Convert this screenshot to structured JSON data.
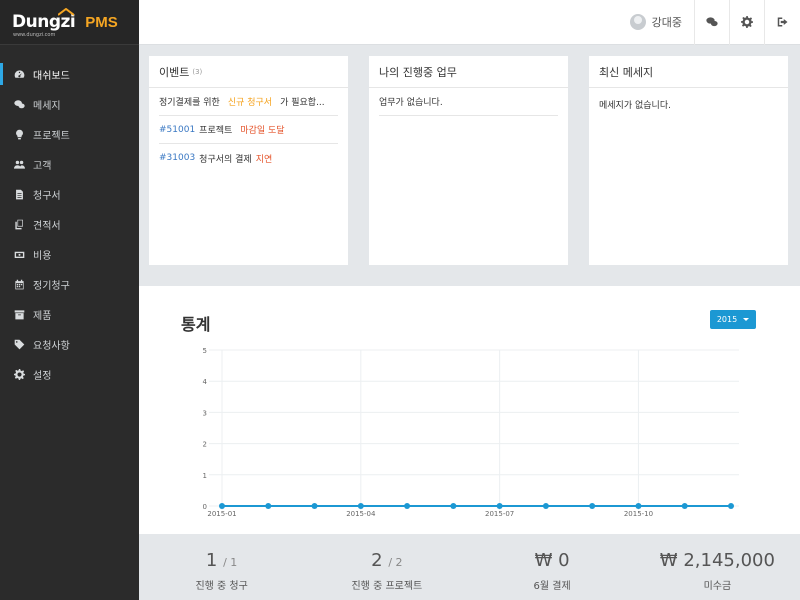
{
  "brand": {
    "logo": "Dungzi",
    "logo_sub": "www.dungzi.com",
    "product": "PMS"
  },
  "sidebar": {
    "items": [
      {
        "label": "대쉬보드",
        "icon": "dashboard-icon",
        "active": true
      },
      {
        "label": "메세지",
        "icon": "chat-icon"
      },
      {
        "label": "프로젝트",
        "icon": "lightbulb-icon"
      },
      {
        "label": "고객",
        "icon": "users-icon"
      },
      {
        "label": "청구서",
        "icon": "document-icon"
      },
      {
        "label": "견적서",
        "icon": "copy-icon"
      },
      {
        "label": "비용",
        "icon": "money-icon"
      },
      {
        "label": "정기청구",
        "icon": "calendar-icon"
      },
      {
        "label": "제품",
        "icon": "archive-icon"
      },
      {
        "label": "요청사항",
        "icon": "tag-icon"
      },
      {
        "label": "설정",
        "icon": "gear-icon"
      }
    ]
  },
  "header": {
    "user_name": "강대중"
  },
  "events": {
    "title": "이벤트",
    "count": "(3)",
    "rows": [
      {
        "prefix": "정기결제를 위한",
        "highlight": "신규 청구서",
        "suffix": "가 필요합..."
      },
      {
        "link": "#51001",
        "text": "프로젝트",
        "status": "마감일 도달"
      },
      {
        "link": "#31003",
        "text": "청구서의 결제",
        "status": "지연"
      }
    ]
  },
  "tasks": {
    "title": "나의 진행중 업무",
    "empty": "업무가 없습니다."
  },
  "messages": {
    "title": "최신 메세지",
    "empty": "메세지가 없습니다."
  },
  "stats": {
    "title": "통계",
    "year": "2015"
  },
  "chart_data": {
    "type": "line",
    "x": [
      "2015-01",
      "2015-02",
      "2015-03",
      "2015-04",
      "2015-05",
      "2015-06",
      "2015-07",
      "2015-08",
      "2015-09",
      "2015-10",
      "2015-11",
      "2015-12"
    ],
    "x_tick_labels": [
      "2015-01",
      "2015-04",
      "2015-07",
      "2015-10"
    ],
    "y_ticks": [
      "0",
      "1",
      "2",
      "3",
      "4",
      "5"
    ],
    "series": [
      {
        "values": [
          0,
          0,
          0,
          0,
          0,
          0,
          0,
          0,
          0,
          0,
          0,
          0
        ],
        "color": "#1c98d3"
      }
    ],
    "ylim": [
      0,
      5
    ],
    "grid": true
  },
  "summary": [
    {
      "value": "1",
      "total": "/ 1",
      "label": "진행 중 청구"
    },
    {
      "value": "2",
      "total": "/ 2",
      "label": "진행 중 프로젝트"
    },
    {
      "value": "₩ 0",
      "total": "",
      "label": "6월 결제"
    },
    {
      "value": "₩ 2,145,000",
      "total": "",
      "label": "미수금"
    }
  ]
}
